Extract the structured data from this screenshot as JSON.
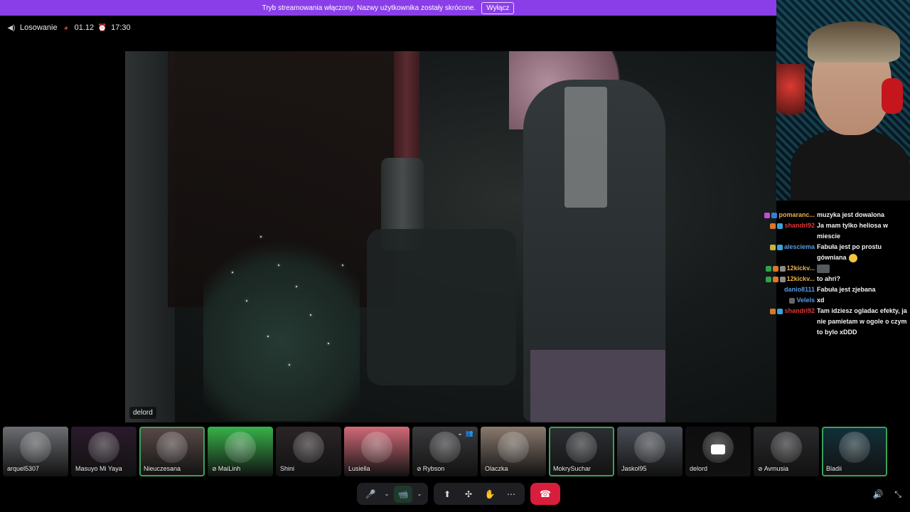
{
  "banner": {
    "text": "Tryb streamowania włączony. Nazwy użytkownika zostały skrócone.",
    "button_label": "Wyłącz"
  },
  "channel": {
    "name": "Losowanie",
    "date": "01.12",
    "time": "17:30",
    "icons": [
      "speaker-icon",
      "santa-emoji-icon",
      "alarm-clock-emoji-icon"
    ]
  },
  "stage": {
    "label": "delord"
  },
  "chat": [
    {
      "badges": [
        "#c04fd0",
        "#3a7bd5"
      ],
      "user": "pomaranc...",
      "color": "#e8b14a",
      "text": "muzyka jest dowalona"
    },
    {
      "badges": [
        "#d9772a",
        "#3aa3d8"
      ],
      "user": "shandri92",
      "color": "#e0383a",
      "text": "Ja mam tylko heliosa w miescie"
    },
    {
      "badges": [
        "#c8b23a",
        "#3aa3d8"
      ],
      "user": "alesciema",
      "color": "#5a9be0",
      "text": "Fabuła jest po prostu gówniana",
      "emoji": true
    },
    {
      "badges": [
        "#2fa34a",
        "#d9772a",
        "#8a8a8a"
      ],
      "user": "12kickv...",
      "color": "#e8b14a",
      "text": "",
      "emote": true
    },
    {
      "badges": [
        "#2fa34a",
        "#d9772a",
        "#8a8a8a"
      ],
      "user": "12kickv...",
      "color": "#e8b14a",
      "text": "to ahri?"
    },
    {
      "badges": [],
      "user": "danio8111",
      "color": "#5a9be0",
      "text": "Fabuła jest zjebana"
    },
    {
      "badges": [
        "#666666"
      ],
      "user": "Velels",
      "color": "#5a9be0",
      "text": "xd"
    },
    {
      "badges": [
        "#d9772a",
        "#3aa3d8"
      ],
      "user": "shandri92",
      "color": "#e0383a",
      "text": "Tam idziesz ogladac efekty, ja nie pamietam w ogole o czym to bylo xDDD"
    }
  ],
  "participants": [
    {
      "name": "arquel5307",
      "muted": false,
      "speaking": false,
      "bg": "#6b6e72"
    },
    {
      "name": "Masuyo Mi Yaya",
      "muted": false,
      "speaking": false,
      "bg": "#2a1a2c"
    },
    {
      "name": "Nieuczesana",
      "muted": false,
      "speaking": true,
      "bg": "#5a4a48"
    },
    {
      "name": "MaiLinh",
      "muted": true,
      "speaking": false,
      "bg": "#38b24a"
    },
    {
      "name": "Shini",
      "muted": false,
      "speaking": false,
      "bg": "#2b2426"
    },
    {
      "name": "Lusiella",
      "muted": false,
      "speaking": false,
      "bg": "#d16a78"
    },
    {
      "name": "Rybson",
      "muted": true,
      "speaking": false,
      "bg": "#3a3a3d"
    },
    {
      "name": "Olaczka",
      "muted": false,
      "speaking": false,
      "bg": "#8a7a6e"
    },
    {
      "name": "MokrySuchar",
      "muted": false,
      "speaking": true,
      "bg": "#2c2f33"
    },
    {
      "name": "Jaskol95",
      "muted": false,
      "speaking": false,
      "bg": "#4a4e56"
    },
    {
      "name": "delord",
      "muted": false,
      "speaking": false,
      "bg": "#0e0e10"
    },
    {
      "name": "Avmusia",
      "muted": true,
      "speaking": false,
      "bg": "#2a2a2d"
    },
    {
      "name": "Bladii",
      "muted": false,
      "speaking": true,
      "bg": "#12303a"
    }
  ],
  "controls": {
    "mic_icon": "🎤",
    "camera_icon": "📹",
    "share_icon": "⬆",
    "activities_icon": "✣",
    "effects_icon": "✋",
    "more_icon": "⋯",
    "hangup_icon": "☎",
    "volume_icon": "🔊",
    "exit_fullscreen_icon": "⤡"
  }
}
